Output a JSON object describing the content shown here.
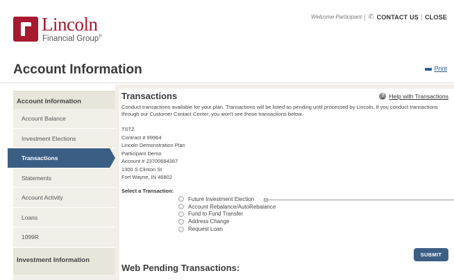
{
  "brand": {
    "logo_word": "Lincoln",
    "logo_sub": "Financial Group",
    "logo_sup": "®",
    "brand_color": "#a6192e"
  },
  "utility": {
    "welcome": "Welcome Participant",
    "contact": "CONTACT US",
    "close": "CLOSE",
    "phone_icon": "phone-icon"
  },
  "page": {
    "title": "Account Information",
    "print": "Print"
  },
  "sidebar": {
    "header": "Account Information",
    "items": [
      {
        "label": "Account Balance"
      },
      {
        "label": "Investment Elections"
      },
      {
        "label": "Transactions",
        "active": true
      },
      {
        "label": "Statements"
      },
      {
        "label": "Account Activity"
      },
      {
        "label": "Loans"
      },
      {
        "label": "1099R"
      }
    ],
    "header2": "Investment Information"
  },
  "main": {
    "title": "Transactions",
    "help": "Help with Transactions",
    "intro": "Conduct transactions available for your plan. Transactions will be listed as pending until processed by Lincoln. If you conduct transactions through our Customer Contact Center, you won't see those transactions below.",
    "address": [
      "TSTZ",
      "Contract # 99964",
      "Lincoln Demonstration Plan",
      "Participant Demo",
      "Account # 23700684367",
      "1300 S Clinton St",
      "Fort Wayne, IN  46802"
    ],
    "select_label": "Select a Transaction:",
    "options": [
      "Future Investment Election",
      "Account Rebalance/AutoRebalance",
      "Fund to Fund Transfer",
      "Address Change",
      "Request Loan"
    ],
    "submit": "SUBMIT",
    "pending_title": "Web Pending Transactions:"
  },
  "colors": {
    "accent": "#3b5e84",
    "sidebar_bg": "#f1efe7"
  }
}
